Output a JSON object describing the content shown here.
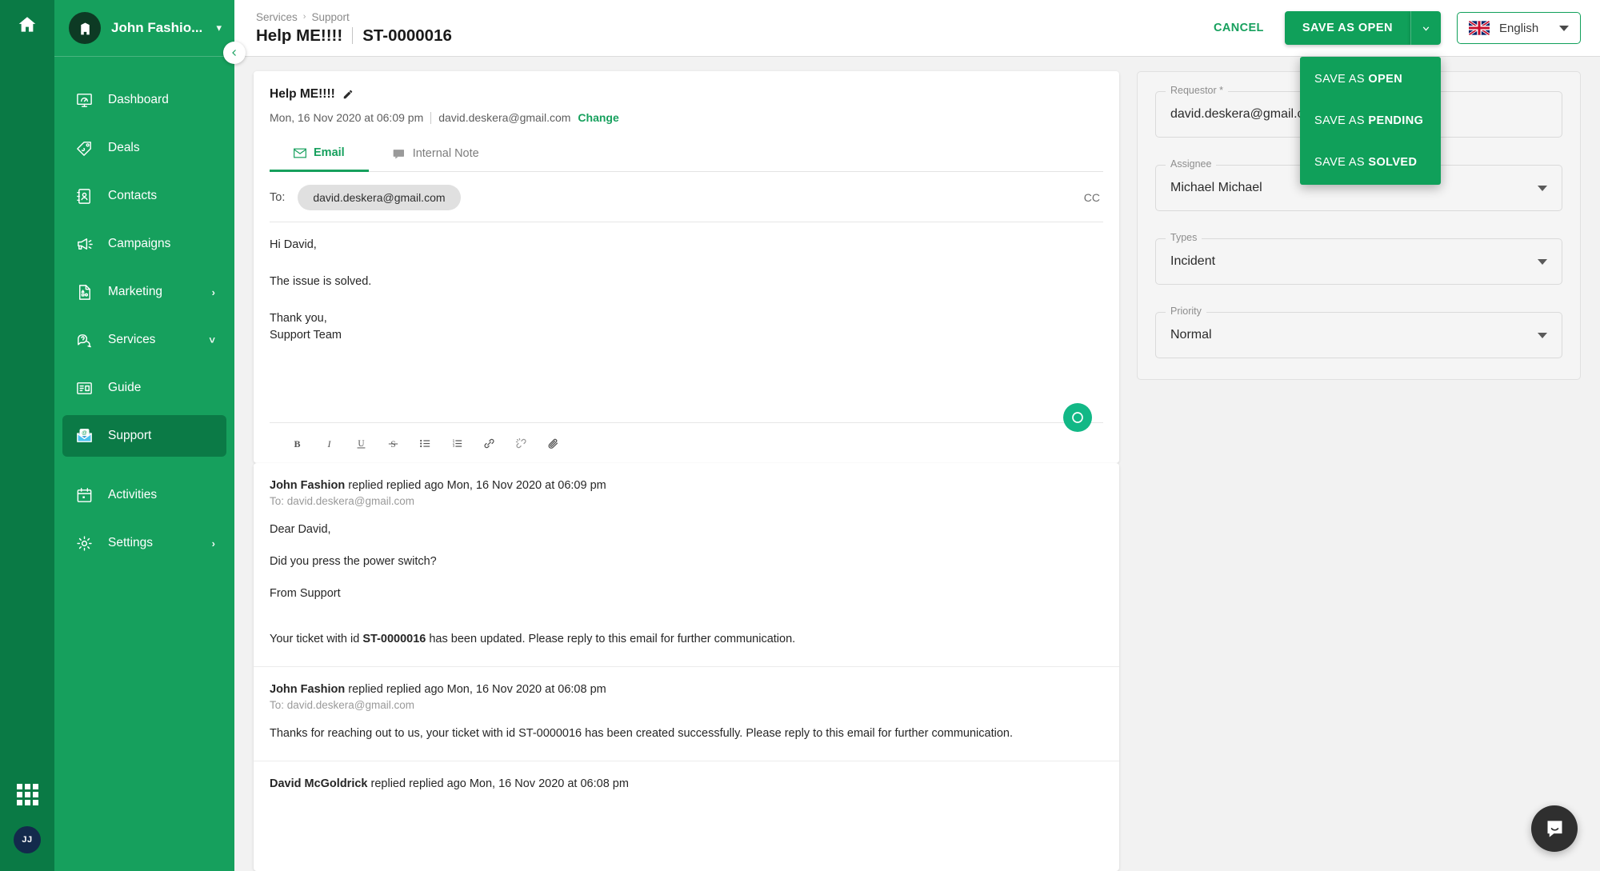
{
  "rail": {
    "home_icon": "home-icon",
    "grid_icon": "apps-grid-icon",
    "avatar_initials": "JJ"
  },
  "sidebar": {
    "org_name": "John Fashio...",
    "org_icon": "building-icon",
    "org_caret_icon": "chevron-down-icon",
    "collapse_icon": "chevron-left-icon",
    "items": [
      {
        "label": "Dashboard",
        "icon": "dashboard-monitor-icon",
        "arrow": "",
        "active": false
      },
      {
        "label": "Deals",
        "icon": "price-tag-icon",
        "arrow": "",
        "active": false
      },
      {
        "label": "Contacts",
        "icon": "contacts-book-icon",
        "arrow": "",
        "active": false
      },
      {
        "label": "Campaigns",
        "icon": "megaphone-icon",
        "arrow": "",
        "active": false
      },
      {
        "label": "Marketing",
        "icon": "document-shapes-icon",
        "arrow": "›",
        "active": false
      },
      {
        "label": "Services",
        "icon": "chat-question-icon",
        "arrow": "˅",
        "active": false
      },
      {
        "label": "Guide",
        "icon": "guide-book-icon",
        "arrow": "",
        "active": false
      },
      {
        "label": "Support",
        "icon": "support-envelope-icon",
        "arrow": "",
        "active": true
      },
      {
        "label": "Activities",
        "icon": "calendar-icon",
        "arrow": "",
        "active": false
      },
      {
        "label": "Settings",
        "icon": "gear-icon",
        "arrow": "›",
        "active": false
      }
    ]
  },
  "topbar": {
    "breadcrumb": {
      "parent": "Services",
      "separator": "›",
      "current": "Support"
    },
    "title_main": "Help ME!!!!",
    "title_id": "ST-0000016",
    "cancel_label": "CANCEL",
    "save_label": "SAVE AS OPEN",
    "save_toggle_icon": "chevron-down-icon",
    "language": {
      "label": "English",
      "flag": "uk-flag-icon",
      "caret_icon": "caret-down-icon"
    },
    "dropdown": {
      "open": true,
      "items": [
        {
          "prefix": "SAVE AS ",
          "strong": "OPEN"
        },
        {
          "prefix": "SAVE AS ",
          "strong": "PENDING"
        },
        {
          "prefix": "SAVE AS ",
          "strong": "SOLVED"
        }
      ]
    }
  },
  "ticket": {
    "subject": "Help ME!!!!",
    "edit_icon": "pencil-icon",
    "timestamp": "Mon, 16 Nov 2020 at 06:09 pm",
    "requester_email": "david.deskera@gmail.com",
    "change_label": "Change",
    "tabs": [
      {
        "label": "Email",
        "icon": "envelope-icon",
        "active": true
      },
      {
        "label": "Internal Note",
        "icon": "note-icon",
        "active": false
      }
    ],
    "to_label": "To:",
    "to_chip": "david.deskera@gmail.com",
    "cc_label": "CC",
    "draft_lines": [
      "Hi David,",
      "The issue is solved.",
      "Thank you,\nSupport Team"
    ],
    "send_icon": "send-circle-icon",
    "toolbar": [
      {
        "name": "bold-icon",
        "glyph": "B"
      },
      {
        "name": "italic-icon",
        "glyph": "I"
      },
      {
        "name": "underline-icon",
        "glyph": "U"
      },
      {
        "name": "strikethrough-icon",
        "glyph": "S"
      },
      {
        "name": "bullet-list-icon",
        "glyph": ""
      },
      {
        "name": "numbered-list-icon",
        "glyph": ""
      },
      {
        "name": "link-icon",
        "glyph": ""
      },
      {
        "name": "unlink-icon",
        "glyph": ""
      },
      {
        "name": "attachment-icon",
        "glyph": ""
      }
    ]
  },
  "thread": [
    {
      "author": "John Fashion",
      "meta": "replied replied ago Mon, 16 Nov 2020 at 06:09 pm",
      "to": "To: david.deskera@gmail.com",
      "paragraphs": [
        "Dear David,",
        "Did you press the power switch?",
        "From Support"
      ],
      "notice_pre": "Your ticket with id ",
      "notice_id": "ST-0000016",
      "notice_post": " has been updated. Please reply to this email for further communication."
    },
    {
      "author": "John Fashion",
      "meta": "replied replied ago Mon, 16 Nov 2020 at 06:08 pm",
      "to": "To: david.deskera@gmail.com",
      "body": "Thanks for reaching out to us, your ticket with id ST-0000016 has been created successfully. Please reply to this email for further communication."
    },
    {
      "author": "David McGoldrick",
      "meta": "replied replied ago Mon, 16 Nov 2020 at 06:08 pm",
      "to": "",
      "body": ""
    }
  ],
  "properties": [
    {
      "label": "Requestor *",
      "value": "david.deskera@gmail.com",
      "has_caret": false
    },
    {
      "label": "Assignee",
      "value": "Michael Michael",
      "has_caret": true
    },
    {
      "label": "Types",
      "value": "Incident",
      "has_caret": true
    },
    {
      "label": "Priority",
      "value": "Normal",
      "has_caret": true
    }
  ],
  "intercom": {
    "icon": "intercom-chat-icon"
  },
  "colors": {
    "brand_green": "#16a05d",
    "rail_green": "#0a7a45",
    "active_green": "#0b7a46",
    "button_green": "#10a05a",
    "teal_fab": "#12b886"
  }
}
